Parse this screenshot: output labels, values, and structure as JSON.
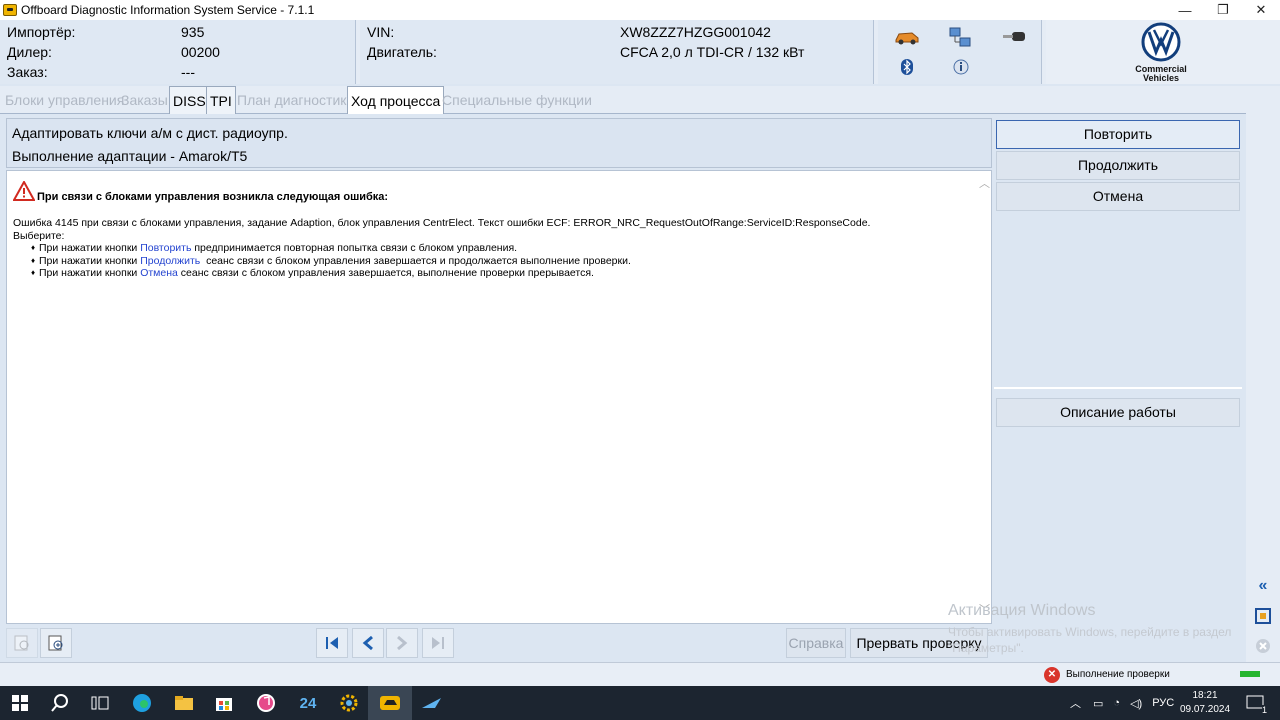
{
  "window": {
    "title": "Offboard Diagnostic Information System Service - 7.1.1",
    "controls": {
      "minimize": "—",
      "maximize": "❐",
      "close": "✕"
    }
  },
  "header": {
    "importer_label": "Импортёр:",
    "importer_value": "935",
    "dealer_label": "Дилер:",
    "dealer_value": "00200",
    "order_label": "Заказ:",
    "order_value": "---",
    "vin_label": "VIN:",
    "vin_value": "XW8ZZZ7HZGG001042",
    "engine_label": "Двигатель:",
    "engine_value": "CFCA 2,0 л TDI-CR / 132 кВт",
    "icons": [
      "car-icon",
      "network-icon",
      "key-icon",
      "bluetooth-icon",
      "info-icon"
    ],
    "logo_text_1": "Commercial",
    "logo_text_2": "Vehicles"
  },
  "tabs": [
    {
      "label": "Блоки управления",
      "state": "disabled"
    },
    {
      "label": "Заказы",
      "state": "disabled"
    },
    {
      "label": "DISS",
      "state": "enabled"
    },
    {
      "label": "TPI",
      "state": "enabled"
    },
    {
      "label": "План диагностики",
      "state": "disabled"
    },
    {
      "label": "Ход процесса",
      "state": "active"
    },
    {
      "label": "Специальные функции",
      "state": "disabled"
    }
  ],
  "main": {
    "line1": "Адаптировать ключи а/м с дист. радиоупр.",
    "line2": "Выполнение адаптации - Amarok/T5",
    "warning_title": "При связи с блоками управления возникла следующая ошибка:",
    "error_text": "Ошибка 4145 при связи с блоками управления, задание Adaption, блок управления CentrElect. Текст ошибки ECF: ERROR_NRC_RequestOutOfRange:ServiceID:ResponseCode.",
    "choose": "Выберите:",
    "bullets": [
      {
        "pre": "При нажатии кнопки ",
        "link": "Повторить",
        "post": " предпринимается повторная попытка связи с блоком управления."
      },
      {
        "pre": "При нажатии кнопки ",
        "link": "Продолжить",
        "post": "  сеанс связи с блоком управления завершается и продолжается выполнение проверки."
      },
      {
        "pre": "При нажатии кнопки ",
        "link": "Отмена",
        "post": " сеанс связи с блоком управления завершается, выполнение проверки прерывается."
      }
    ]
  },
  "right_panel": {
    "retry": "Повторить",
    "continue": "Продолжить",
    "cancel": "Отмена",
    "job_description": "Описание работы"
  },
  "toolbar": {
    "help": "Справка",
    "abort": "Прервать проверку"
  },
  "status": {
    "text": "Выполнение проверки"
  },
  "watermark": {
    "line1": "Активация Windows",
    "line2": "Чтобы активировать Windows, перейдите в раздел \"Параметры\"."
  },
  "taskbar": {
    "lang": "РУС",
    "time": "18:21",
    "date": "09.07.2024",
    "notifications": "1"
  },
  "colors": {
    "accent": "#3a66b0",
    "link": "#2444d0",
    "error": "#d9352b",
    "progress": "#25b52f"
  }
}
